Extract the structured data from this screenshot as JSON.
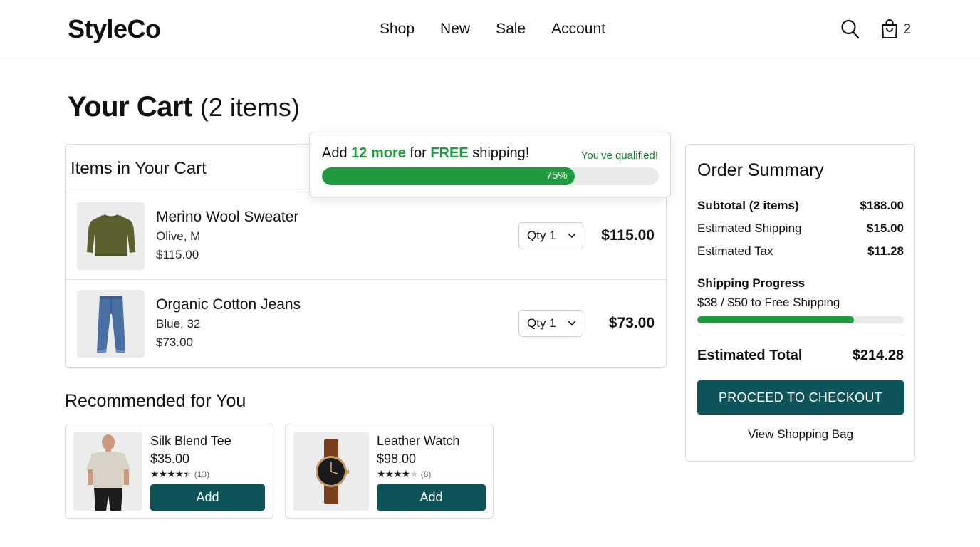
{
  "header": {
    "logo": "StyleCo",
    "nav": [
      "Shop",
      "New",
      "Sale",
      "Account"
    ],
    "cart_count": "2",
    "icons": [
      "search-icon",
      "shopping-bag-icon"
    ]
  },
  "page": {
    "title": "Your Cart",
    "count": "(2 items)"
  },
  "cart": {
    "heading": "Items in Your Cart",
    "items": [
      {
        "name": "Merino Wool Sweater",
        "variant": "Olive, M",
        "price": "$115.00",
        "qty": "Qty 1",
        "total": "$115.00"
      },
      {
        "name": "Organic Cotton Jeans",
        "variant": "Blue, 32",
        "price": "$73.00",
        "qty": "Qty 1",
        "total": "$73.00"
      }
    ]
  },
  "free_shipping": {
    "text_prefix": "Add ",
    "amount": "12 more",
    "text_mid": " for ",
    "free": "FREE",
    "text_suffix": " shipping!",
    "qualified": "You've qualified!",
    "percent_label": "75%",
    "progress": 0.75
  },
  "recommended": {
    "title": "Recommended for You",
    "items": [
      {
        "name": "Silk Blend Tee",
        "price": "$35.00",
        "rating": 4.5,
        "reviews": "(13)",
        "add_label": "Add"
      },
      {
        "name": "Leather Watch",
        "price": "$98.00",
        "rating": 4,
        "reviews": "(8)",
        "add_label": "Add"
      }
    ]
  },
  "summary": {
    "title": "Order Summary",
    "rows": [
      {
        "label": "Subtotal (2 items)",
        "value": "$188.00"
      },
      {
        "label": "Estimated Shipping",
        "value": "$15.00"
      },
      {
        "label": "Estimated Tax",
        "value": "$11.28"
      }
    ],
    "progress_title": "Shipping Progress",
    "progress_text": "$38 / $50 to Free Shipping",
    "progress": 0.76,
    "total_label": "Estimated Total",
    "total_value": "$214.28",
    "checkout_label": "PROCEED TO CHECKOUT",
    "view_bag_label": "View Shopping Bag"
  },
  "colors": {
    "accent": "#0f535a",
    "progress_green": "#1f9a3f"
  }
}
